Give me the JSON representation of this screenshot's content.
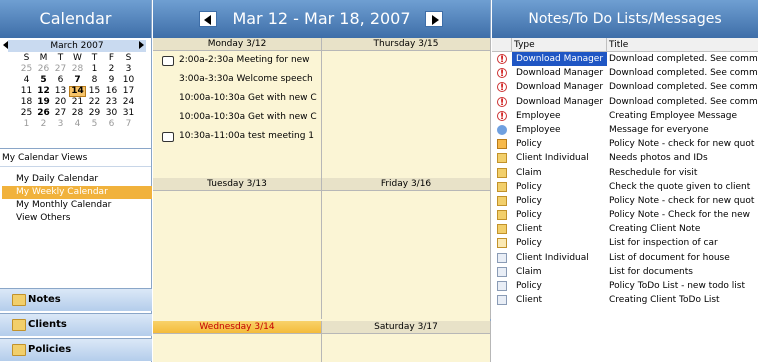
{
  "left": {
    "title": "Calendar",
    "mini_month": "March 2007",
    "dow": [
      "S",
      "M",
      "T",
      "W",
      "T",
      "F",
      "S"
    ],
    "weeks": [
      [
        {
          "d": "25",
          "o": true
        },
        {
          "d": "26",
          "o": true
        },
        {
          "d": "27",
          "o": true
        },
        {
          "d": "28",
          "o": true
        },
        {
          "d": "1"
        },
        {
          "d": "2"
        },
        {
          "d": "3"
        }
      ],
      [
        {
          "d": "4"
        },
        {
          "d": "5",
          "b": true
        },
        {
          "d": "6"
        },
        {
          "d": "7",
          "b": true
        },
        {
          "d": "8"
        },
        {
          "d": "9"
        },
        {
          "d": "10"
        }
      ],
      [
        {
          "d": "11"
        },
        {
          "d": "12",
          "b": true
        },
        {
          "d": "13"
        },
        {
          "d": "14",
          "t": true
        },
        {
          "d": "15"
        },
        {
          "d": "16"
        },
        {
          "d": "17"
        }
      ],
      [
        {
          "d": "18"
        },
        {
          "d": "19",
          "b": true
        },
        {
          "d": "20"
        },
        {
          "d": "21"
        },
        {
          "d": "22"
        },
        {
          "d": "23"
        },
        {
          "d": "24"
        }
      ],
      [
        {
          "d": "25"
        },
        {
          "d": "26",
          "b": true
        },
        {
          "d": "27"
        },
        {
          "d": "28"
        },
        {
          "d": "29"
        },
        {
          "d": "30"
        },
        {
          "d": "31"
        }
      ],
      [
        {
          "d": "1",
          "o": true
        },
        {
          "d": "2",
          "o": true
        },
        {
          "d": "3",
          "o": true
        },
        {
          "d": "4",
          "o": true
        },
        {
          "d": "5",
          "o": true
        },
        {
          "d": "6",
          "o": true
        },
        {
          "d": "7",
          "o": true
        }
      ]
    ],
    "views_title": "My Calendar Views",
    "views": [
      "My Daily Calendar",
      "My Weekly Calendar",
      "My Monthly Calendar",
      "View Others"
    ],
    "selected_view": 1,
    "nav": [
      "Notes",
      "Clients",
      "Policies"
    ]
  },
  "center": {
    "title": "Mar 12 - Mar 18, 2007",
    "days": {
      "mon": "Monday 3/12",
      "thu": "Thursday 3/15",
      "tue": "Tuesday 3/13",
      "fri": "Friday 3/16",
      "wed": "Wednesday 3/14",
      "sat": "Saturday 3/17"
    },
    "monday_appts": [
      {
        "text": "2:00a-2:30a Meeting for new",
        "icon": true
      },
      {
        "text": "3:00a-3:30a Welcome speech",
        "icon": false
      },
      {
        "text": "10:00a-10:30a Get with new C",
        "icon": false
      },
      {
        "text": "10:00a-10:30a Get with new C",
        "icon": false
      },
      {
        "text": "10:30a-11:00a test meeting 1",
        "icon": true
      }
    ]
  },
  "right": {
    "title": "Notes/To Do Lists/Messages",
    "col_type": "Type",
    "col_title": "Title",
    "rows": [
      {
        "icon": "alert",
        "type": "Download Manager",
        "title": "Download completed. See comm",
        "sel": true
      },
      {
        "icon": "alert",
        "type": "Download Manager",
        "title": "Download completed. See comm"
      },
      {
        "icon": "alert",
        "type": "Download Manager",
        "title": "Download completed. See comm"
      },
      {
        "icon": "alert",
        "type": "Download Manager",
        "title": "Download completed. See comm"
      },
      {
        "icon": "alert",
        "type": "Employee",
        "title": "Creating Employee Message"
      },
      {
        "icon": "info",
        "type": "Employee",
        "title": "Message for everyone"
      },
      {
        "icon": "warn",
        "type": "Policy",
        "title": "Policy Note - check for new quot"
      },
      {
        "icon": "envelope",
        "type": "Client Individual",
        "title": "Needs photos and IDs"
      },
      {
        "icon": "envelope",
        "type": "Claim",
        "title": "Reschedule for visit"
      },
      {
        "icon": "envelope",
        "type": "Policy",
        "title": "Check the quote given to client"
      },
      {
        "icon": "envelope",
        "type": "Policy",
        "title": "Policy Note - check for new quot"
      },
      {
        "icon": "envelope",
        "type": "Policy",
        "title": "Policy Note - Check for the new"
      },
      {
        "icon": "envelope",
        "type": "Client",
        "title": "Creating Client Note"
      },
      {
        "icon": "note2",
        "type": "Policy",
        "title": "List for inspection of car"
      },
      {
        "icon": "note",
        "type": "Client Individual",
        "title": "List of document for house"
      },
      {
        "icon": "note",
        "type": "Claim",
        "title": "List for documents"
      },
      {
        "icon": "note",
        "type": "Policy",
        "title": "Policy ToDo List - new todo list"
      },
      {
        "icon": "note",
        "type": "Client",
        "title": "Creating Client ToDo List"
      }
    ]
  }
}
